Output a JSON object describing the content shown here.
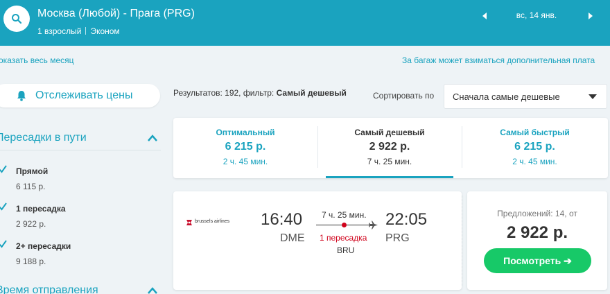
{
  "header": {
    "route": "Москва (Любой) - Прага (PRG)",
    "passengers": "1 взрослый",
    "cabin": "Эконом",
    "date": "вс, 14 янв."
  },
  "links": {
    "show_month": "оказать весь месяц",
    "baggage_note": "За багаж может взиматься дополнительная плата"
  },
  "sidebar": {
    "track_prices": "Отслеживать цены",
    "stops_title": "Пересадки в пути",
    "stops": [
      {
        "label": "Прямой",
        "price": "6 115 р.",
        "checked": true
      },
      {
        "label": "1 пересадка",
        "price": "2 922 р.",
        "checked": true
      },
      {
        "label": "2+ пересадки",
        "price": "9 188 р.",
        "checked": true
      }
    ],
    "departure_title": "Время отправления"
  },
  "results": {
    "summary_prefix": "Результатов: 192, фильтр: ",
    "summary_filter": "Самый дешевый",
    "sort_label": "Сортировать по",
    "sort_value": "Сначала самые дешевые"
  },
  "tabs": [
    {
      "name": "Оптимальный",
      "price": "6 215 р.",
      "duration": "2 ч. 45 мин.",
      "active": false
    },
    {
      "name": "Самый дешевый",
      "price": "2 922 р.",
      "duration": "7 ч. 25 мин.",
      "active": true
    },
    {
      "name": "Самый быстрый",
      "price": "6 215 р.",
      "duration": "2 ч. 45 мин.",
      "active": false
    }
  ],
  "ticket": {
    "airline": "brussels airlines",
    "dep_time": "16:40",
    "dep_code": "DME",
    "arr_time": "22:05",
    "arr_code": "PRG",
    "duration": "7 ч. 25 мин.",
    "stops": "1 пересадка",
    "via": "BRU",
    "offers": "Предложений: 14, от",
    "price": "2 922 р.",
    "view_button": "Посмотреть ➔"
  },
  "colors": {
    "brand": "#1aa3bf",
    "button_green": "#17c968",
    "stop_red": "#d0021b"
  }
}
